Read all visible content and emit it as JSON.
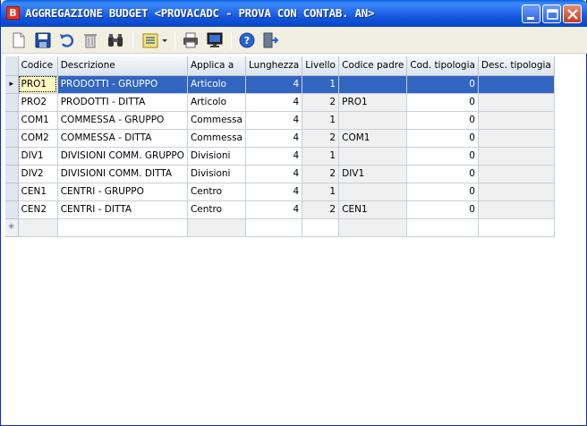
{
  "window": {
    "title": "AGGREGAZIONE BUDGET <PROVACADC - PROVA CON CONTAB. AN>",
    "app_icon_letter": "B"
  },
  "toolbar": {
    "tools": [
      {
        "name": "new-document-icon"
      },
      {
        "name": "save-icon"
      },
      {
        "name": "undo-icon"
      },
      {
        "name": "delete-icon"
      },
      {
        "name": "search-binoculars-icon"
      },
      {
        "name": "view-options-icon"
      },
      {
        "name": "print-icon"
      },
      {
        "name": "preview-monitor-icon"
      },
      {
        "name": "help-icon"
      },
      {
        "name": "exit-door-icon"
      }
    ]
  },
  "grid": {
    "columns": [
      "Codice",
      "Descrizione",
      "Applica a",
      "Lunghezza",
      "Livello",
      "Codice padre",
      "Cod. tipologia",
      "Desc. tipologia"
    ],
    "rows": [
      {
        "codice": "PRO1",
        "descrizione": "PRODOTTI - GRUPPO",
        "applica": "Articolo",
        "lunghezza": "4",
        "livello": "1",
        "padre": "",
        "cod_tip": "0",
        "desc_tip": ""
      },
      {
        "codice": "PRO2",
        "descrizione": "PRODOTTI - DITTA",
        "applica": "Articolo",
        "lunghezza": "4",
        "livello": "2",
        "padre": "PRO1",
        "cod_tip": "0",
        "desc_tip": ""
      },
      {
        "codice": "COM1",
        "descrizione": "COMMESSA - GRUPPO",
        "applica": "Commessa",
        "lunghezza": "4",
        "livello": "1",
        "padre": "",
        "cod_tip": "0",
        "desc_tip": ""
      },
      {
        "codice": "COM2",
        "descrizione": "COMMESSA - DITTA",
        "applica": "Commessa",
        "lunghezza": "4",
        "livello": "2",
        "padre": "COM1",
        "cod_tip": "0",
        "desc_tip": ""
      },
      {
        "codice": "DIV1",
        "descrizione": "DIVISIONI COMM. GRUPPO",
        "applica": "Divisioni",
        "lunghezza": "4",
        "livello": "1",
        "padre": "",
        "cod_tip": "0",
        "desc_tip": ""
      },
      {
        "codice": "DIV2",
        "descrizione": "DIVISIONI COMM. DITTA",
        "applica": "Divisioni",
        "lunghezza": "4",
        "livello": "2",
        "padre": "DIV1",
        "cod_tip": "0",
        "desc_tip": ""
      },
      {
        "codice": "CEN1",
        "descrizione": "CENTRI - GRUPPO",
        "applica": "Centro",
        "lunghezza": "4",
        "livello": "1",
        "padre": "",
        "cod_tip": "0",
        "desc_tip": ""
      },
      {
        "codice": "CEN2",
        "descrizione": "CENTRI - DITTA",
        "applica": "Centro",
        "lunghezza": "4",
        "livello": "2",
        "padre": "CEN1",
        "cod_tip": "0",
        "desc_tip": ""
      }
    ],
    "current_row_marker": "▸",
    "new_row_marker": "✳"
  },
  "colors": {
    "titlebar": "#0a5fe6",
    "selection": "#3165c0",
    "readonly_cell": "#f0f0f0",
    "toolbar": "#f1efe2"
  }
}
